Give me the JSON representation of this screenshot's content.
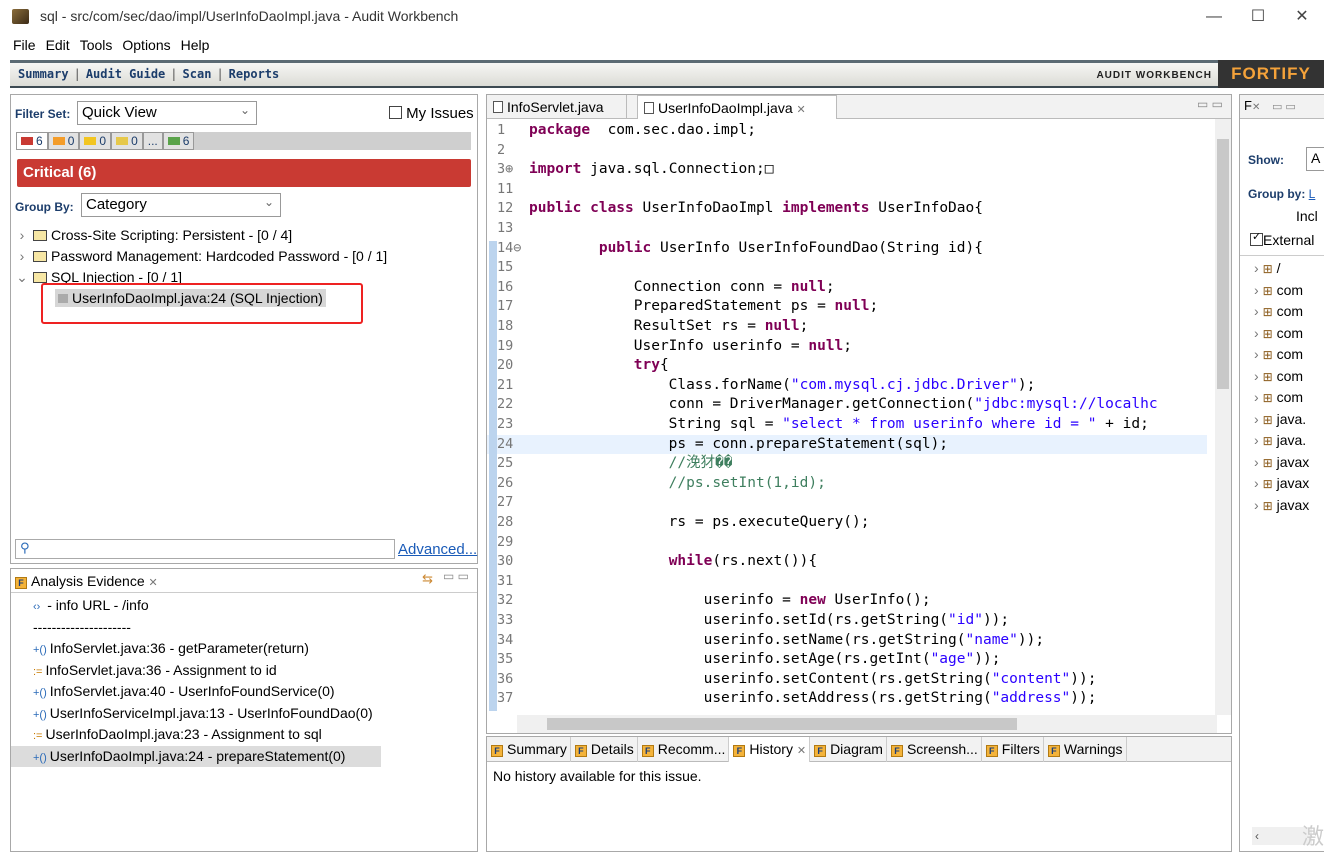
{
  "window": {
    "title": "sql - src/com/sec/dao/impl/UserInfoDaoImpl.java - Audit Workbench",
    "minimize": "—",
    "maximize": "☐",
    "close": "✕"
  },
  "menu": [
    "File",
    "Edit",
    "Tools",
    "Options",
    "Help"
  ],
  "nav": {
    "links": [
      "Summary",
      "Audit Guide",
      "Scan",
      "Reports"
    ],
    "brand_text": "AUDIT WORKBENCH",
    "logo": "FORTIFY"
  },
  "issues": {
    "filter_set_label": "Filter Set:",
    "filter_set_value": "Quick View",
    "my_issues_label": "My Issues",
    "severity_tabs": [
      {
        "count": "6",
        "color": "#c93a33"
      },
      {
        "count": "0",
        "color": "#f39c2a"
      },
      {
        "count": "0",
        "color": "#f2c521"
      },
      {
        "count": "0",
        "color": "#e6c84a"
      },
      {
        "count": "...",
        "color": ""
      },
      {
        "count": "6",
        "color": "#5aa34a"
      }
    ],
    "critical_label": "Critical (6)",
    "group_by_label": "Group By:",
    "group_by_value": "Category",
    "tree": [
      {
        "label": "Cross-Site Scripting: Persistent - [0 / 4]",
        "expanded": false
      },
      {
        "label": "Password Management: Hardcoded Password - [0 / 1]",
        "expanded": false
      },
      {
        "label": "SQL Injection - [0 / 1]",
        "expanded": true
      }
    ],
    "selected_issue": "UserInfoDaoImpl.java:24 (SQL Injection)",
    "advanced_link": "Advanced..."
  },
  "evidence": {
    "title": "Analysis Evidence",
    "rows": [
      {
        "icon": "url-icon",
        "glyph": "‹›",
        "text": "- info URL - /info"
      },
      {
        "icon": "none",
        "glyph": "",
        "text": "---------------------"
      },
      {
        "icon": "call-icon",
        "glyph": "+()",
        "text": "InfoServlet.java:36 - getParameter(return)"
      },
      {
        "icon": "assign-icon",
        "glyph": ":=",
        "text": "InfoServlet.java:36 - Assignment to id"
      },
      {
        "icon": "call-icon",
        "glyph": "+()",
        "text": "InfoServlet.java:40 - UserInfoFoundService(0)"
      },
      {
        "icon": "call-icon",
        "glyph": "+()",
        "text": "UserInfoServiceImpl.java:13 - UserInfoFoundDao(0)"
      },
      {
        "icon": "assign-icon",
        "glyph": ":=",
        "text": "UserInfoDaoImpl.java:23 - Assignment to sql"
      },
      {
        "icon": "call-icon",
        "glyph": "+()",
        "text": "UserInfoDaoImpl.java:24 - prepareStatement(0)"
      }
    ]
  },
  "editor": {
    "tabs": [
      "InfoServlet.java",
      "UserInfoDaoImpl.java"
    ],
    "lines": [
      {
        "n": "1",
        "segs": [
          [
            "kw",
            "package"
          ],
          [
            "",
            "  com.sec.dao.impl;"
          ]
        ]
      },
      {
        "n": "2",
        "segs": []
      },
      {
        "n": "3⊕",
        "segs": [
          [
            "kw",
            "import"
          ],
          [
            "",
            " java.sql.Connection;□"
          ]
        ]
      },
      {
        "n": "11",
        "segs": []
      },
      {
        "n": "12",
        "segs": [
          [
            "kw",
            "public class"
          ],
          [
            "",
            " UserInfoDaoImpl "
          ],
          [
            "kw",
            "implements"
          ],
          [
            "",
            " UserInfoDao{"
          ]
        ]
      },
      {
        "n": "13",
        "segs": []
      },
      {
        "n": "14⊖",
        "segs": [
          [
            "",
            "        "
          ],
          [
            "kw",
            "public"
          ],
          [
            "",
            " UserInfo UserInfoFoundDao(String id){"
          ]
        ]
      },
      {
        "n": "15",
        "segs": []
      },
      {
        "n": "16",
        "segs": [
          [
            "",
            "            Connection conn = "
          ],
          [
            "kw",
            "null"
          ],
          [
            "",
            ";"
          ]
        ]
      },
      {
        "n": "17",
        "segs": [
          [
            "",
            "            PreparedStatement ps = "
          ],
          [
            "kw",
            "null"
          ],
          [
            "",
            ";"
          ]
        ]
      },
      {
        "n": "18",
        "segs": [
          [
            "",
            "            ResultSet rs = "
          ],
          [
            "kw",
            "null"
          ],
          [
            "",
            ";"
          ]
        ]
      },
      {
        "n": "19",
        "segs": [
          [
            "",
            "            UserInfo userinfo = "
          ],
          [
            "kw",
            "null"
          ],
          [
            "",
            ";"
          ]
        ]
      },
      {
        "n": "20",
        "segs": [
          [
            "",
            "            "
          ],
          [
            "kw",
            "try"
          ],
          [
            "",
            "{"
          ]
        ]
      },
      {
        "n": "21",
        "segs": [
          [
            "",
            "                Class.forName("
          ],
          [
            "str",
            "\"com.mysql.cj.jdbc.Driver\""
          ],
          [
            "",
            ");"
          ]
        ]
      },
      {
        "n": "22",
        "segs": [
          [
            "",
            "                conn = DriverManager.getConnection("
          ],
          [
            "str",
            "\"jdbc:mysql://localhc"
          ]
        ]
      },
      {
        "n": "23",
        "segs": [
          [
            "",
            "                String sql = "
          ],
          [
            "str",
            "\"select * from userinfo where id = \""
          ],
          [
            "",
            " + id;"
          ]
        ]
      },
      {
        "n": "24",
        "segs": [
          [
            "",
            "                ps = conn.prepareStatement(sql);"
          ]
        ],
        "highlight": true
      },
      {
        "n": "25",
        "segs": [
          [
            "cm",
            "                //浼犲��"
          ]
        ]
      },
      {
        "n": "26",
        "segs": [
          [
            "cm",
            "                //ps.setInt(1,id);"
          ]
        ]
      },
      {
        "n": "27",
        "segs": []
      },
      {
        "n": "28",
        "segs": [
          [
            "",
            "                rs = ps.executeQuery();"
          ]
        ]
      },
      {
        "n": "29",
        "segs": []
      },
      {
        "n": "30",
        "segs": [
          [
            "",
            "                "
          ],
          [
            "kw",
            "while"
          ],
          [
            "",
            "(rs.next()){"
          ]
        ]
      },
      {
        "n": "31",
        "segs": []
      },
      {
        "n": "32",
        "segs": [
          [
            "",
            "                    userinfo = "
          ],
          [
            "kw",
            "new"
          ],
          [
            "",
            " UserInfo();"
          ]
        ]
      },
      {
        "n": "33",
        "segs": [
          [
            "",
            "                    userinfo.setId(rs.getString("
          ],
          [
            "str",
            "\"id\""
          ],
          [
            "",
            "));"
          ]
        ]
      },
      {
        "n": "34",
        "segs": [
          [
            "",
            "                    userinfo.setName(rs.getString("
          ],
          [
            "str",
            "\"name\""
          ],
          [
            "",
            "));"
          ]
        ]
      },
      {
        "n": "35",
        "segs": [
          [
            "",
            "                    userinfo.setAge(rs.getInt("
          ],
          [
            "str",
            "\"age\""
          ],
          [
            "",
            "));"
          ]
        ]
      },
      {
        "n": "36",
        "segs": [
          [
            "",
            "                    userinfo.setContent(rs.getString("
          ],
          [
            "str",
            "\"content\""
          ],
          [
            "",
            "));"
          ]
        ]
      },
      {
        "n": "37",
        "segs": [
          [
            "",
            "                    userinfo.setAddress(rs.getString("
          ],
          [
            "str",
            "\"address\""
          ],
          [
            "",
            "));"
          ]
        ]
      }
    ]
  },
  "bottom": {
    "tabs": [
      "Summary",
      "Details",
      "Recomm...",
      "History",
      "Diagram",
      "Screensh...",
      "Filters",
      "Warnings"
    ],
    "active_tab": "History",
    "message": "No history available for this issue."
  },
  "right": {
    "tab": "F",
    "show_label": "Show:",
    "show_value": "A",
    "group_by_label": "Group by:",
    "group_by_value": "L",
    "include_label": "Incl",
    "external_label": "External",
    "packages": [
      "/",
      "com",
      "com",
      "com",
      "com",
      "com",
      "com",
      "java.",
      "java.",
      "javax",
      "javax",
      "javax"
    ],
    "watermark": "激"
  }
}
